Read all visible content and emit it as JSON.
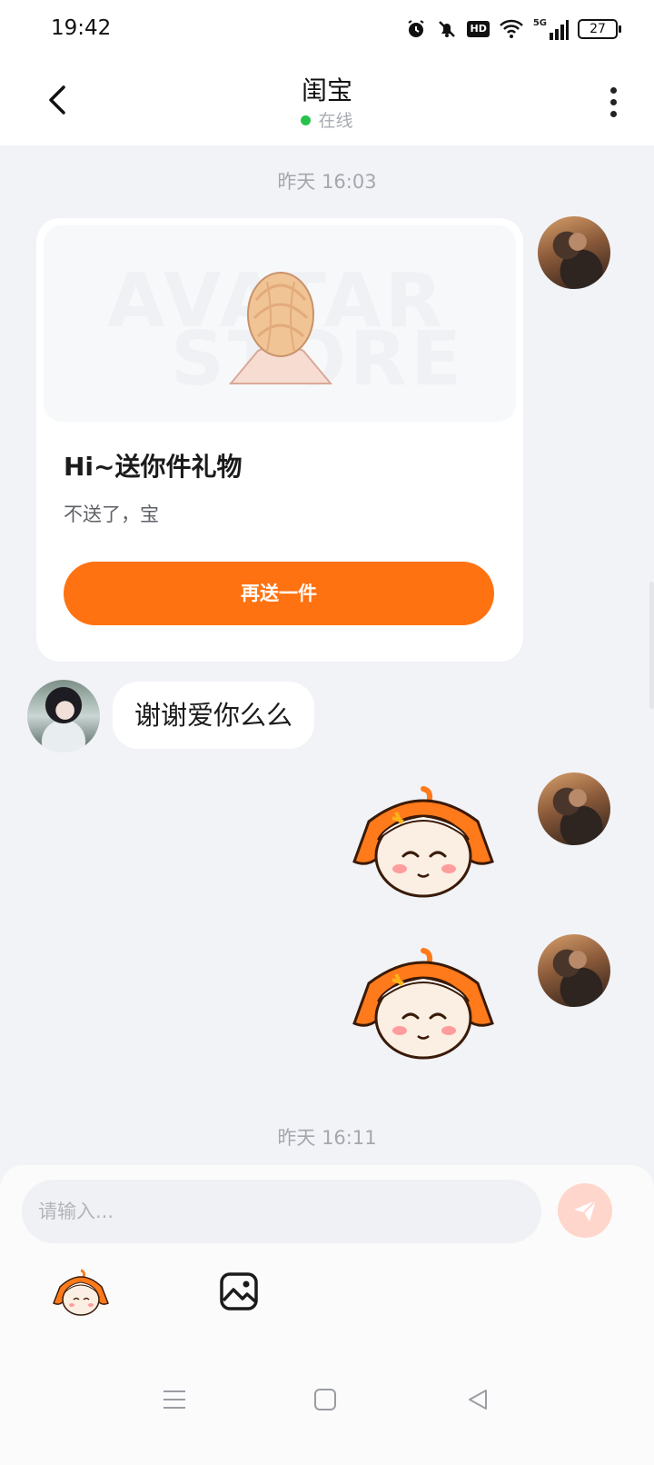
{
  "status_bar": {
    "time": "19:42",
    "hd_label": "HD",
    "network_label": "5G",
    "battery": "27"
  },
  "header": {
    "title": "闺宝",
    "status": "在线",
    "status_color": "#27c24c"
  },
  "messages": {
    "timestamp_1": "昨天 16:03",
    "gift_card": {
      "watermark_line1": "AVATAR",
      "watermark_line2": "STORE",
      "title": "Hi~送你件礼物",
      "subtitle": "不送了，宝",
      "button_label": "再送一件"
    },
    "text_message": "谢谢爱你么么",
    "timestamp_2": "昨天 16:11"
  },
  "input": {
    "placeholder": "请输入..."
  },
  "icons": {
    "back": "chevron-left-icon",
    "more": "more-vertical-icon",
    "send": "send-icon",
    "emoji": "sticker-icon",
    "image": "image-icon",
    "nav_menu": "menu-icon",
    "nav_home": "home-icon",
    "nav_back": "triangle-back-icon"
  },
  "colors": {
    "accent": "#ff7211",
    "background": "#f1f3f7",
    "send_button": "#ffd6cc"
  }
}
